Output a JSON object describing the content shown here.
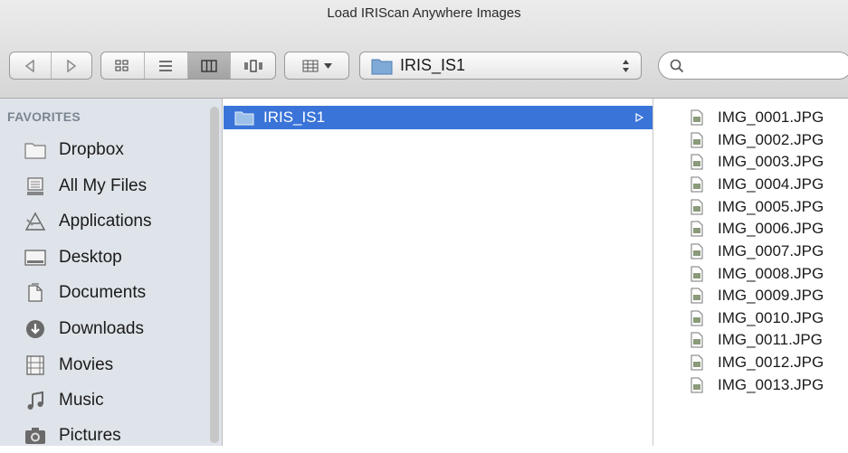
{
  "window": {
    "title": "Load IRIScan Anywhere Images"
  },
  "toolbar": {
    "path_popup": {
      "label": "IRIS_IS1"
    },
    "search": {
      "placeholder": ""
    }
  },
  "sidebar": {
    "heading": "FAVORITES",
    "items": [
      {
        "label": "Dropbox",
        "icon": "folder-icon"
      },
      {
        "label": "All My Files",
        "icon": "files-icon"
      },
      {
        "label": "Applications",
        "icon": "applications-icon"
      },
      {
        "label": "Desktop",
        "icon": "desktop-icon"
      },
      {
        "label": "Documents",
        "icon": "documents-icon"
      },
      {
        "label": "Downloads",
        "icon": "downloads-icon"
      },
      {
        "label": "Movies",
        "icon": "movies-icon"
      },
      {
        "label": "Music",
        "icon": "music-icon"
      },
      {
        "label": "Pictures",
        "icon": "pictures-icon"
      }
    ]
  },
  "columns": {
    "col1": {
      "selected": "IRIS_IS1"
    },
    "files": [
      "IMG_0001.JPG",
      "IMG_0002.JPG",
      "IMG_0003.JPG",
      "IMG_0004.JPG",
      "IMG_0005.JPG",
      "IMG_0006.JPG",
      "IMG_0007.JPG",
      "IMG_0008.JPG",
      "IMG_0009.JPG",
      "IMG_0010.JPG",
      "IMG_0011.JPG",
      "IMG_0012.JPG",
      "IMG_0013.JPG"
    ]
  },
  "colors": {
    "selection": "#3a74d8",
    "sidebar_bg": "#dfe4ea",
    "folder": "#7fa9d6"
  }
}
